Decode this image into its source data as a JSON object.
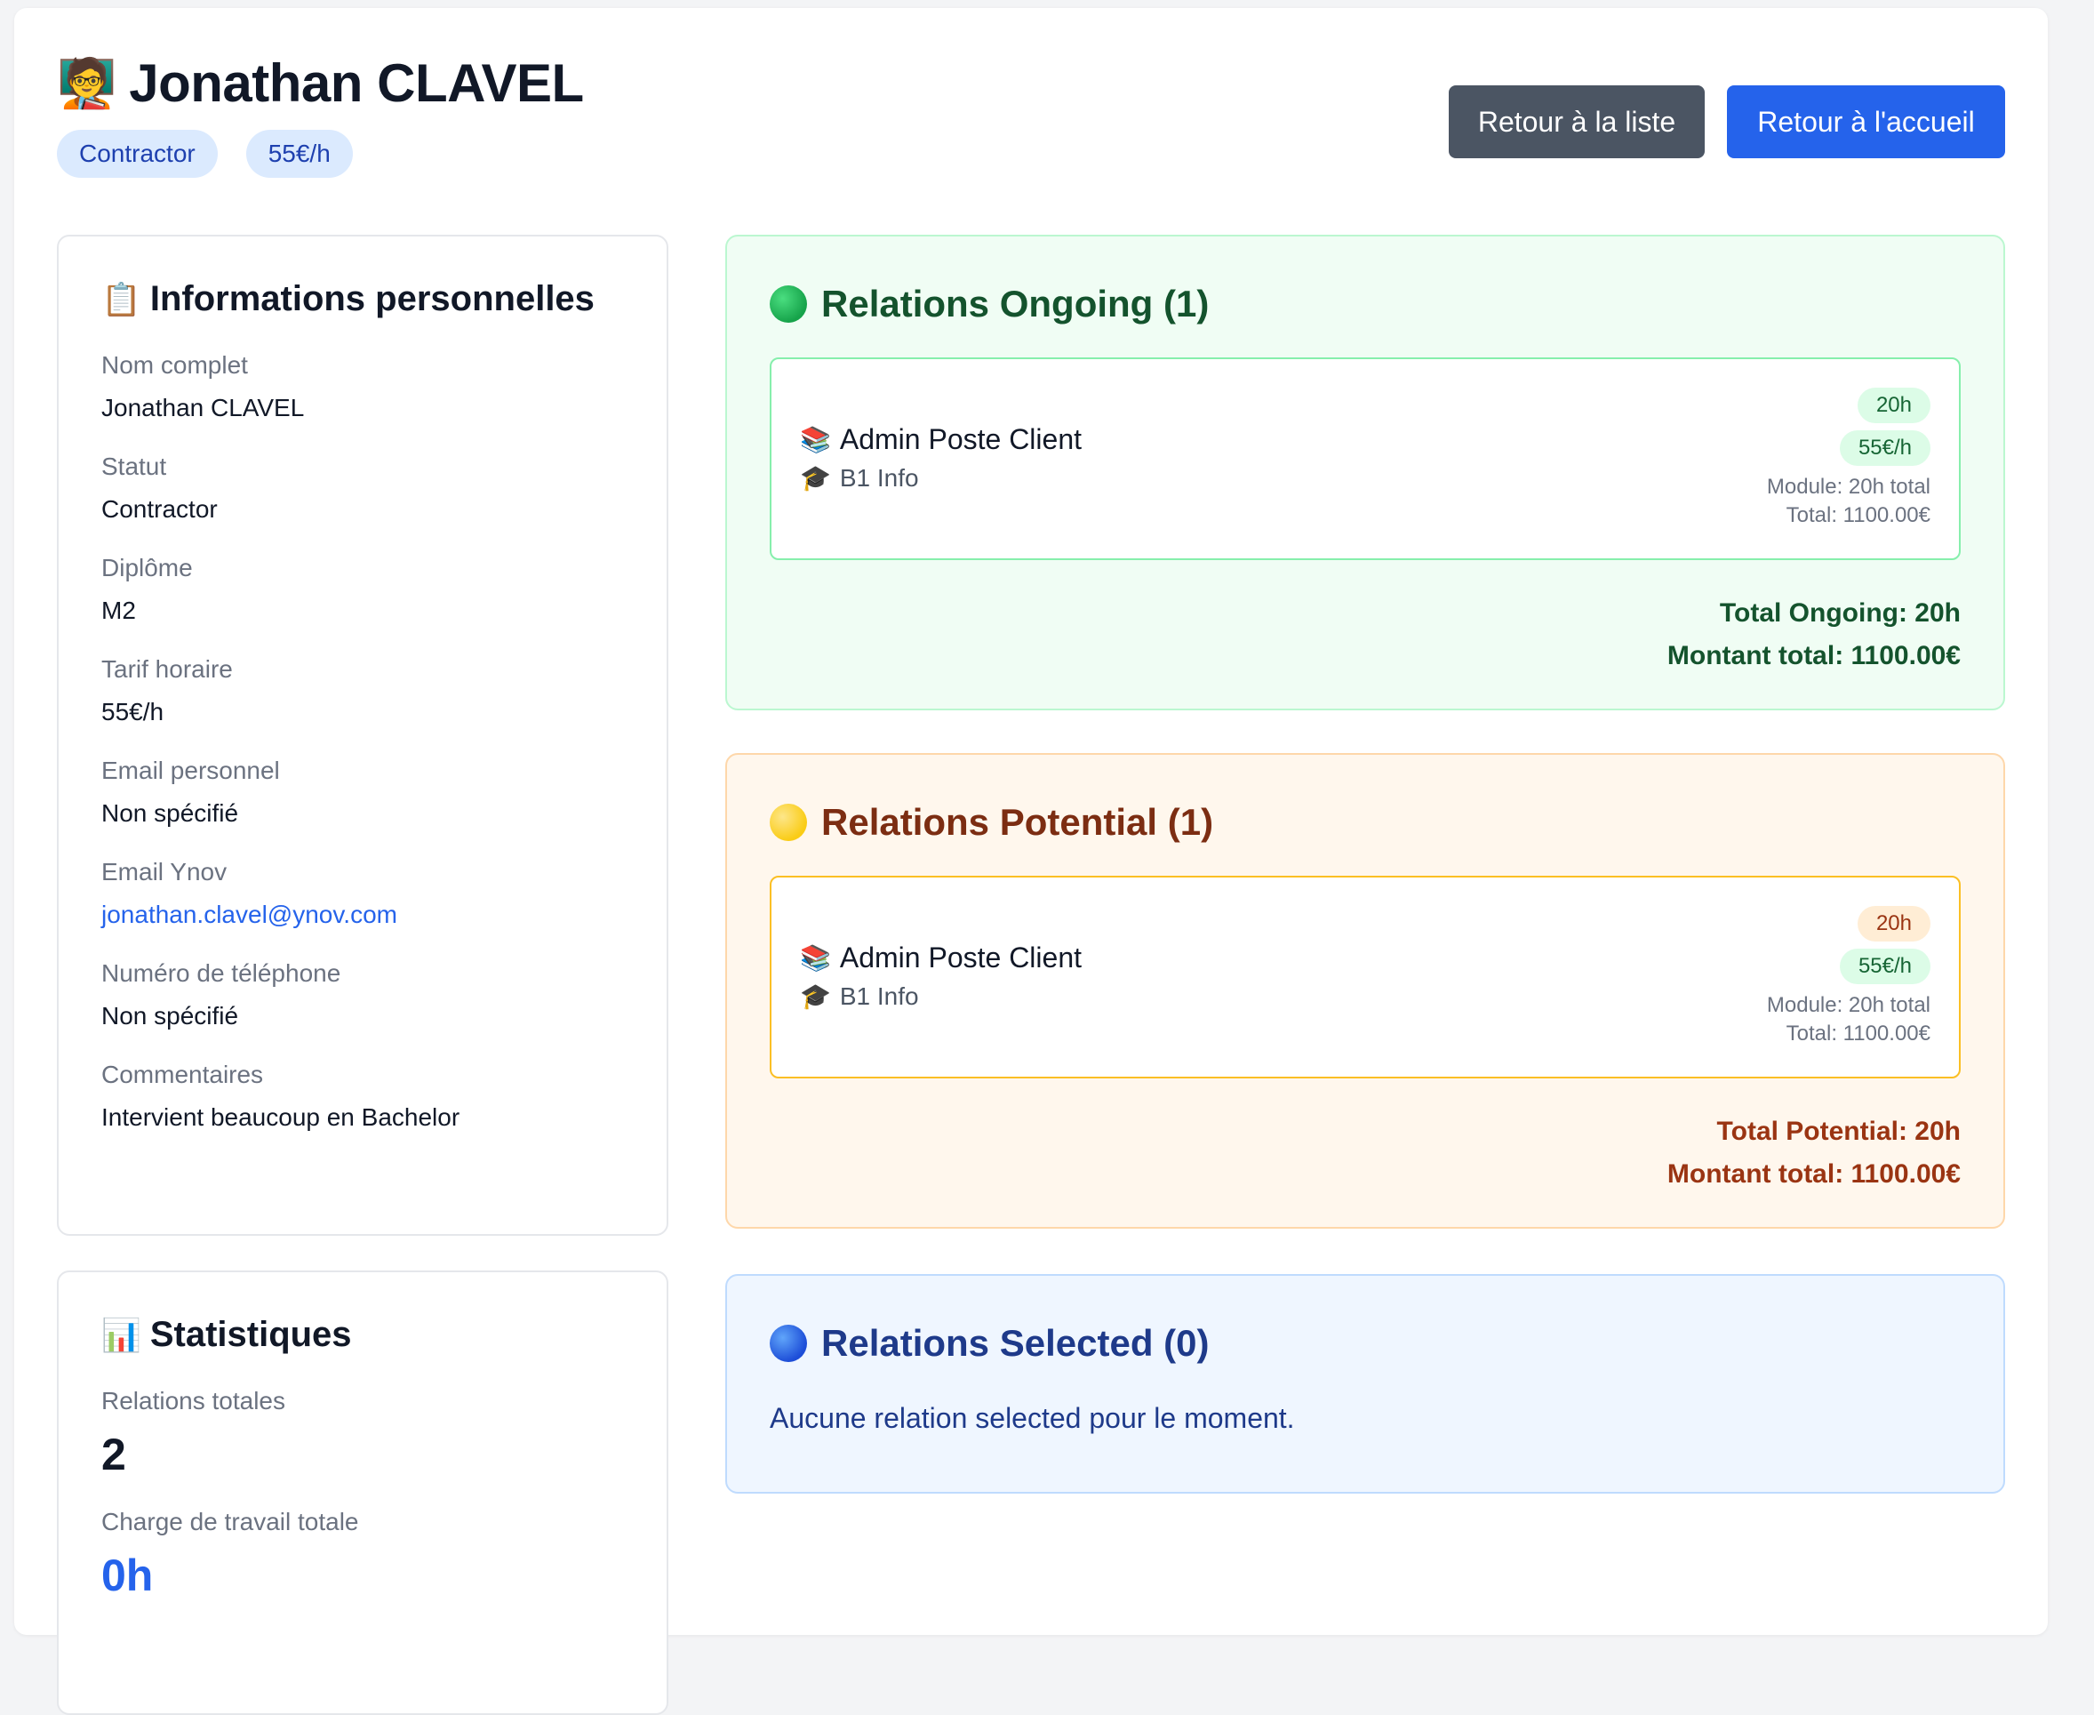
{
  "header": {
    "emoji": "🧑‍🏫",
    "name": "Jonathan CLAVEL",
    "badges": [
      "Contractor",
      "55€/h"
    ],
    "actions": {
      "back_list": "Retour à la liste",
      "back_home": "Retour à l'accueil"
    }
  },
  "info": {
    "icon": "📋",
    "title": "Informations personnelles",
    "fields": [
      {
        "label": "Nom complet",
        "value": "Jonathan CLAVEL"
      },
      {
        "label": "Statut",
        "value": "Contractor"
      },
      {
        "label": "Diplôme",
        "value": "M2"
      },
      {
        "label": "Tarif horaire",
        "value": "55€/h"
      },
      {
        "label": "Email personnel",
        "value": "Non spécifié"
      },
      {
        "label": "Email Ynov",
        "value": "jonathan.clavel@ynov.com"
      },
      {
        "label": "Numéro de téléphone",
        "value": "Non spécifié"
      },
      {
        "label": "Commentaires",
        "value": "Intervient beaucoup en Bachelor"
      }
    ]
  },
  "stats": {
    "icon": "📊",
    "title": "Statistiques",
    "total_relations_label": "Relations totales",
    "total_relations_value": "2",
    "workload_label": "Charge de travail totale",
    "workload_value": "0h"
  },
  "ongoing": {
    "title": "Relations Ongoing (1)",
    "color": "#16a34a",
    "item": {
      "module_icon": "📚",
      "module": "Admin Poste Client",
      "class_icon": "🎓",
      "class": "B1 Info",
      "hours": "20h",
      "rate": "55€/h",
      "module_total": "Module: 20h total",
      "total": "Total: 1100.00€"
    },
    "total_hours": "Total Ongoing: 20h",
    "total_amount": "Montant total: 1100.00€"
  },
  "potential": {
    "title": "Relations Potential (1)",
    "color": "#facc15",
    "item": {
      "module_icon": "📚",
      "module": "Admin Poste Client",
      "class_icon": "🎓",
      "class": "B1 Info",
      "hours": "20h",
      "rate": "55€/h",
      "module_total": "Module: 20h total",
      "total": "Total: 1100.00€"
    },
    "total_hours": "Total Potential: 20h",
    "total_amount": "Montant total: 1100.00€"
  },
  "selected": {
    "title": "Relations Selected (0)",
    "color": "#1d4ed8",
    "empty": "Aucune relation selected pour le moment."
  }
}
